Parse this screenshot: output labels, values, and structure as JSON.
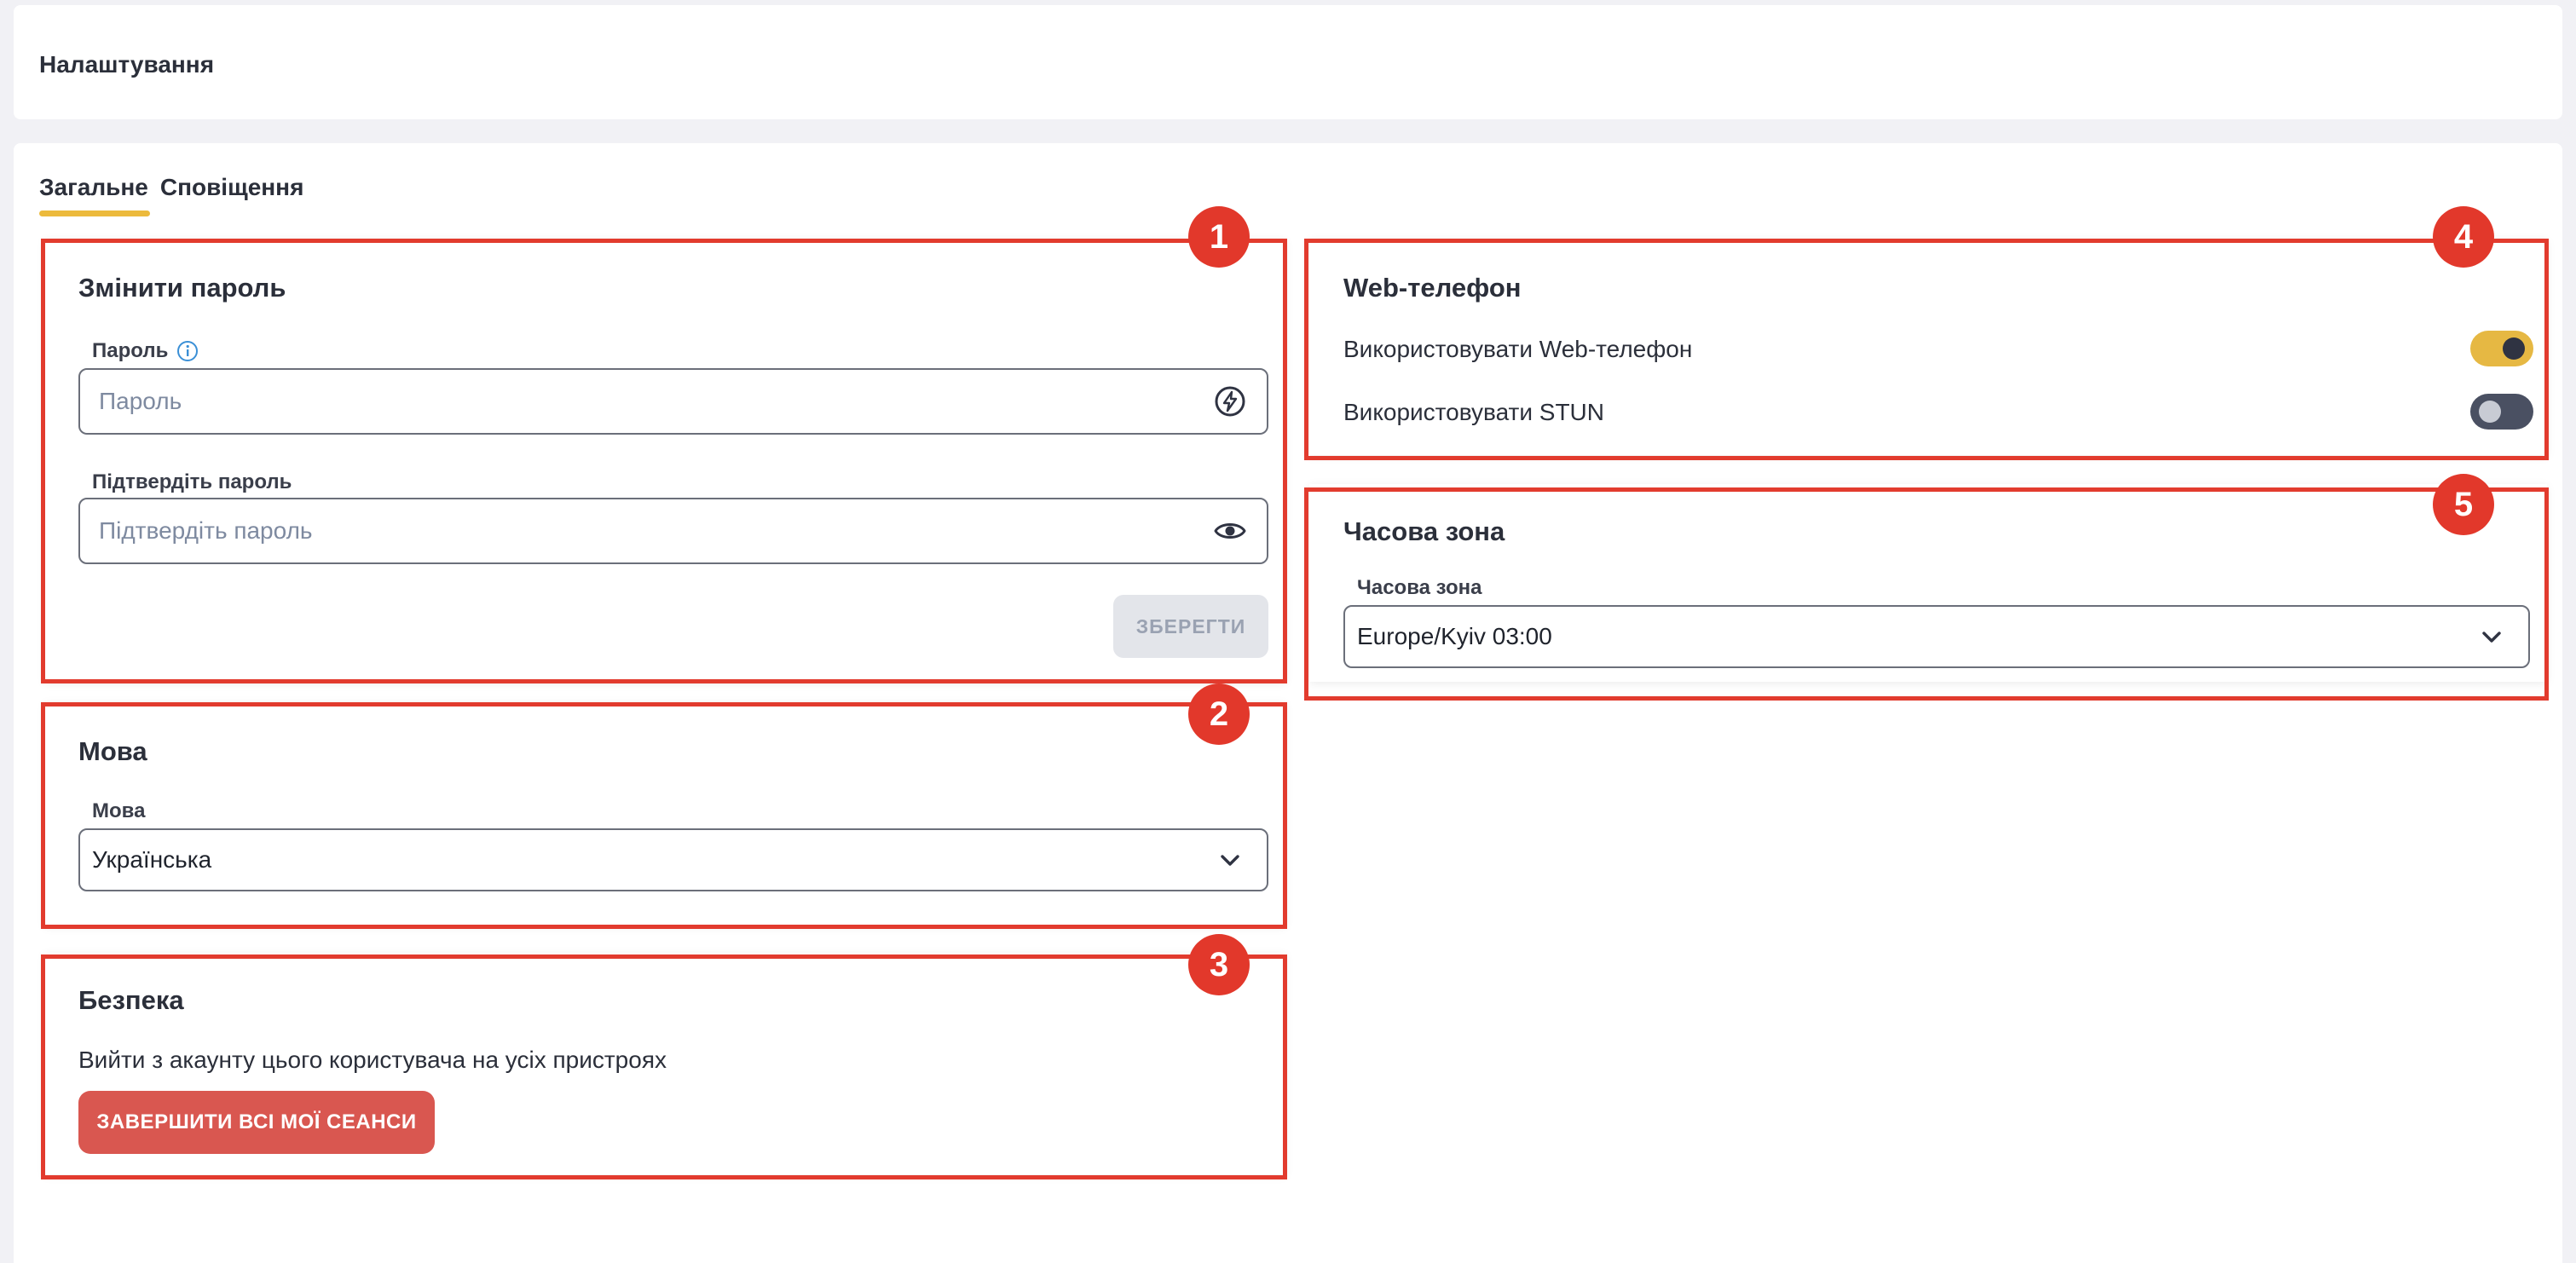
{
  "header": {
    "title": "Налаштування"
  },
  "tabs": [
    {
      "label": "Загальне",
      "active": true
    },
    {
      "label": "Сповіщення",
      "active": false
    }
  ],
  "password_card": {
    "badge": "1",
    "title": "Змінити пароль",
    "password_label": "Пароль",
    "password_placeholder": "Пароль",
    "confirm_label": "Підтвердіть пароль",
    "confirm_placeholder": "Підтвердіть пароль",
    "save_label": "ЗБЕРЕГТИ"
  },
  "language_card": {
    "badge": "2",
    "title": "Мова",
    "field_label": "Мова",
    "selected": "Українська"
  },
  "security_card": {
    "badge": "3",
    "title": "Безпека",
    "description": "Вийти з акаунту цього користувача на усіх пристроях",
    "button_label": "ЗАВЕРШИТИ ВСІ МОЇ СЕАНСИ"
  },
  "webphone_card": {
    "badge": "4",
    "title": "Web-телефон",
    "use_webphone_label": "Використовувати Web-телефон",
    "use_webphone_on": true,
    "use_stun_label": "Використовувати STUN",
    "use_stun_on": false
  },
  "timezone_card": {
    "badge": "5",
    "title": "Часова зона",
    "field_label": "Часова зона",
    "selected": "Europe/Kyiv 03:00"
  },
  "colors": {
    "accent": "#ecba3c",
    "annotation_red": "#e23b2e",
    "danger_button": "#d95750"
  }
}
